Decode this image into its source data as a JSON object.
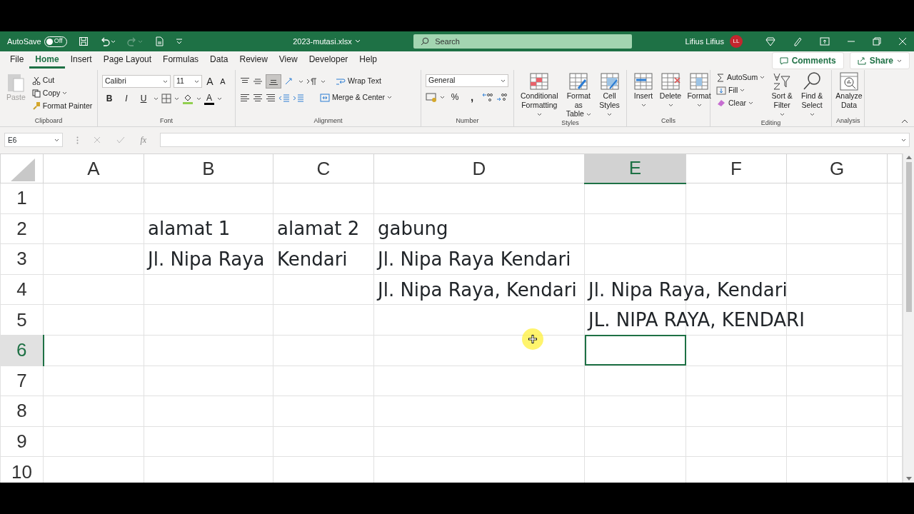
{
  "titlebar": {
    "autosave_label": "AutoSave",
    "autosave_toggle": {
      "label": "Off",
      "on": false
    },
    "redo": {
      "disabled": true
    },
    "filename": "2023-mutasi.xlsx",
    "search": {
      "placeholder": "Search"
    },
    "user": "Lifius Lifius",
    "avatar": "LL"
  },
  "tabs": [
    {
      "label": "File",
      "selected": false
    },
    {
      "label": "Home",
      "selected": true
    },
    {
      "label": "Insert",
      "selected": false
    },
    {
      "label": "Page Layout",
      "selected": false
    },
    {
      "label": "Formulas",
      "selected": false
    },
    {
      "label": "Data",
      "selected": false
    },
    {
      "label": "Review",
      "selected": false
    },
    {
      "label": "View",
      "selected": false
    },
    {
      "label": "Developer",
      "selected": false
    },
    {
      "label": "Help",
      "selected": false
    }
  ],
  "ribbon_actions": {
    "comments": "Comments",
    "share": "Share"
  },
  "ribbon": {
    "clipboard": {
      "label": "Clipboard",
      "paste": {
        "label": "Paste",
        "disabled": true
      },
      "cut": "Cut",
      "copy": "Copy",
      "format_painter": "Format Painter"
    },
    "font": {
      "label": "Font",
      "font_name": "Calibri",
      "font_size": "11",
      "grow": "A",
      "shrink": "A",
      "bold": "B",
      "italic": "I",
      "underline": "U",
      "font_color": "A"
    },
    "alignment": {
      "label": "Alignment",
      "bottom_align": {
        "pressed": true
      },
      "wrap_text": "Wrap Text",
      "merge_center": "Merge & Center"
    },
    "number": {
      "label": "Number",
      "format": "General",
      "percent": "%",
      "comma": ","
    },
    "styles": {
      "label": "Styles",
      "conditional_formatting": "Conditional Formatting",
      "format_as_table": "Format as Table",
      "cell_styles": "Cell Styles"
    },
    "cells": {
      "label": "Cells",
      "insert": "Insert",
      "delete": "Delete",
      "format": "Format"
    },
    "editing": {
      "label": "Editing",
      "autosum": "AutoSum",
      "fill": "Fill",
      "clear": "Clear",
      "sort_filter": "Sort & Filter",
      "find_select": "Find & Select"
    },
    "analysis": {
      "label": "Analysis",
      "analyze_data": "Analyze Data"
    }
  },
  "formula_bar": {
    "name_box": "E6",
    "fx": "fx"
  },
  "columns": [
    {
      "label": "A",
      "selected": false
    },
    {
      "label": "B",
      "selected": false
    },
    {
      "label": "C",
      "selected": false
    },
    {
      "label": "D",
      "selected": false
    },
    {
      "label": "E",
      "selected": true
    },
    {
      "label": "F",
      "selected": false
    },
    {
      "label": "G",
      "selected": false
    }
  ],
  "rows": [
    {
      "header": "1",
      "selected": false,
      "cells": [
        null,
        null,
        null,
        null,
        null,
        null,
        null
      ]
    },
    {
      "header": "2",
      "selected": false,
      "cells": [
        null,
        "alamat 1",
        "alamat 2",
        "gabung",
        null,
        null,
        null
      ]
    },
    {
      "header": "3",
      "selected": false,
      "cells": [
        null,
        "Jl. Nipa Raya",
        "Kendari",
        "Jl. Nipa Raya Kendari",
        null,
        null,
        null
      ]
    },
    {
      "header": "4",
      "selected": false,
      "cells": [
        null,
        null,
        null,
        "Jl. Nipa Raya, Kendari",
        "Jl. Nipa Raya, Kendari",
        null,
        null
      ]
    },
    {
      "header": "5",
      "selected": false,
      "cells": [
        null,
        null,
        null,
        null,
        "JL. NIPA RAYA, KENDARI",
        null,
        null
      ]
    },
    {
      "header": "6",
      "selected": true,
      "cells": [
        null,
        null,
        null,
        null,
        null,
        null,
        null
      ]
    },
    {
      "header": "7",
      "selected": false,
      "cells": [
        null,
        null,
        null,
        null,
        null,
        null,
        null
      ]
    },
    {
      "header": "8",
      "selected": false,
      "cells": [
        null,
        null,
        null,
        null,
        null,
        null,
        null
      ]
    },
    {
      "header": "9",
      "selected": false,
      "cells": [
        null,
        null,
        null,
        null,
        null,
        null,
        null
      ]
    },
    {
      "header": "10",
      "selected": false,
      "cells": [
        null,
        null,
        null,
        null,
        null,
        null,
        null
      ]
    }
  ]
}
